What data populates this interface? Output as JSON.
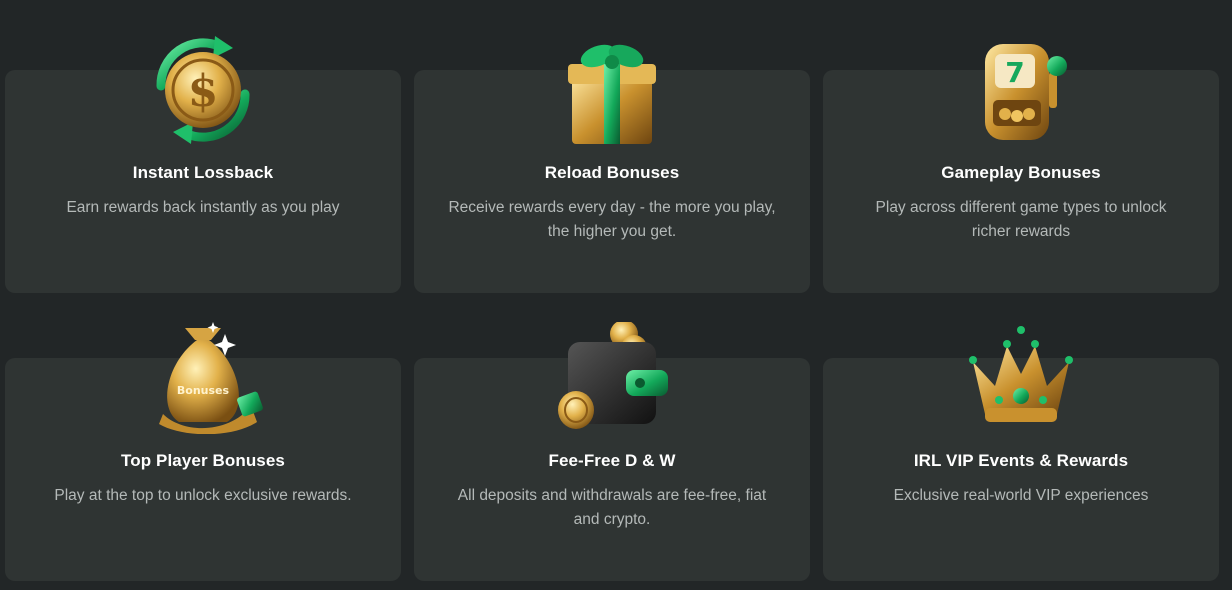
{
  "cards": [
    {
      "title": "Instant Lossback",
      "description": "Earn rewards back instantly as you play",
      "icon": "coin-cycle-icon"
    },
    {
      "title": "Reload Bonuses",
      "description": "Receive rewards every day - the more you play, the higher you get.",
      "icon": "gift-box-icon"
    },
    {
      "title": "Gameplay Bonuses",
      "description": "Play across different game types to unlock richer rewards",
      "icon": "slot-machine-icon"
    },
    {
      "title": "Top Player Bonuses",
      "description": "Play at the top to unlock exclusive rewards.",
      "icon": "money-bag-icon",
      "icon_label": "Bonuses"
    },
    {
      "title": "Fee-Free D & W",
      "description": "All deposits and withdrawals are fee-free, fiat and crypto.",
      "icon": "wallet-icon"
    },
    {
      "title": "IRL VIP Events & Rewards",
      "description": "Exclusive real-world VIP experiences",
      "icon": "crown-icon"
    }
  ],
  "colors": {
    "background": "#222627",
    "card": "#2f3433",
    "gold": "#d9a93e",
    "green": "#1fbf6a",
    "title": "#ffffff",
    "text": "#b4b9b8"
  }
}
